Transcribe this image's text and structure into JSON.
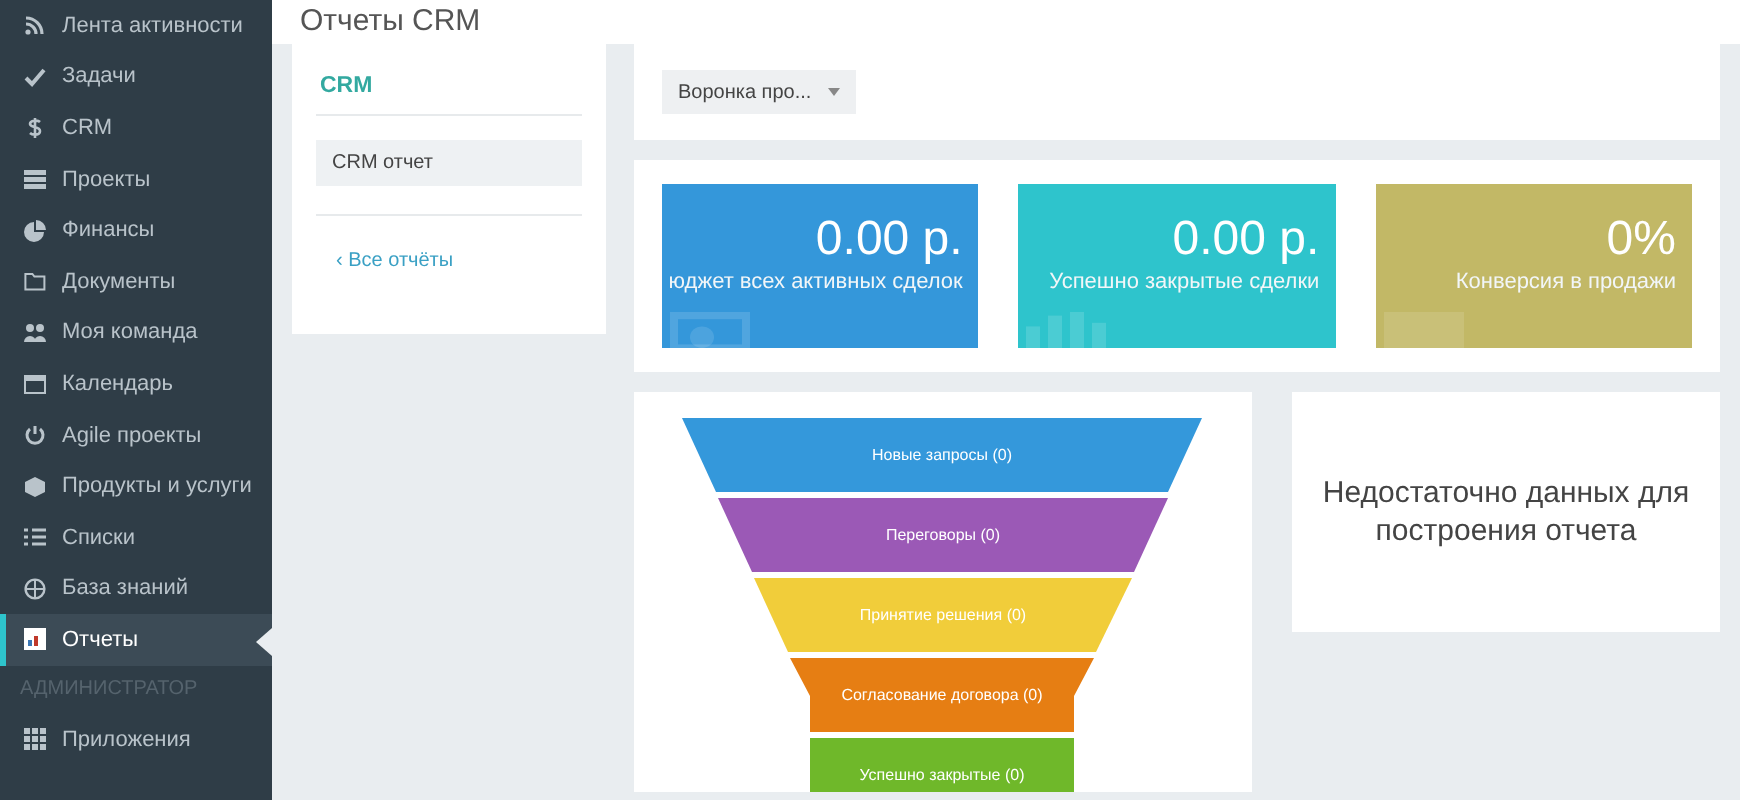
{
  "sidebar": {
    "items": [
      {
        "label": "Лента активности",
        "selected": false
      },
      {
        "label": "Задачи",
        "selected": false
      },
      {
        "label": "CRM",
        "selected": false
      },
      {
        "label": "Проекты",
        "selected": false
      },
      {
        "label": "Финансы",
        "selected": false
      },
      {
        "label": "Документы",
        "selected": false
      },
      {
        "label": "Моя команда",
        "selected": false
      },
      {
        "label": "Календарь",
        "selected": false
      },
      {
        "label": "Agile проекты",
        "selected": false
      },
      {
        "label": "Продукты и услуги",
        "selected": false
      },
      {
        "label": "Списки",
        "selected": false
      },
      {
        "label": "База знаний",
        "selected": false
      },
      {
        "label": "Отчеты",
        "selected": true
      }
    ],
    "admin_section": {
      "title": "АДМИНИСТРАТОР",
      "items": [
        {
          "label": "Приложения",
          "selected": false
        }
      ]
    }
  },
  "page_title": "Отчеты CRM",
  "reports_panel": {
    "title": "CRM",
    "items": [
      {
        "label": "CRM отчет",
        "selected": true
      }
    ],
    "back_link": "‹ Все отчёты"
  },
  "report_select": {
    "value": "Воронка про..."
  },
  "tiles": [
    {
      "value": "0.00 р.",
      "label": "юджет всех активных сделок",
      "color": "#3497da"
    },
    {
      "value": "0.00 р.",
      "label": "Успешно закрытые сделки",
      "color": "#2ec4cc"
    },
    {
      "value": "0%",
      "label": "Конверсия в продажи",
      "color": "#c2b866"
    }
  ],
  "funnel": {
    "stages": [
      {
        "label": "Новые запросы (0)",
        "color": "#3498db"
      },
      {
        "label": "Переговоры (0)",
        "color": "#9b59b6"
      },
      {
        "label": "Принятие решения (0)",
        "color": "#f1cd3a"
      },
      {
        "label": "Согласование договора (0)",
        "color": "#e67e13"
      },
      {
        "label": "Успешно закрытые (0)",
        "color": "#6fb82a"
      }
    ]
  },
  "empty_message": "Недостаточно данных для построения отчета"
}
